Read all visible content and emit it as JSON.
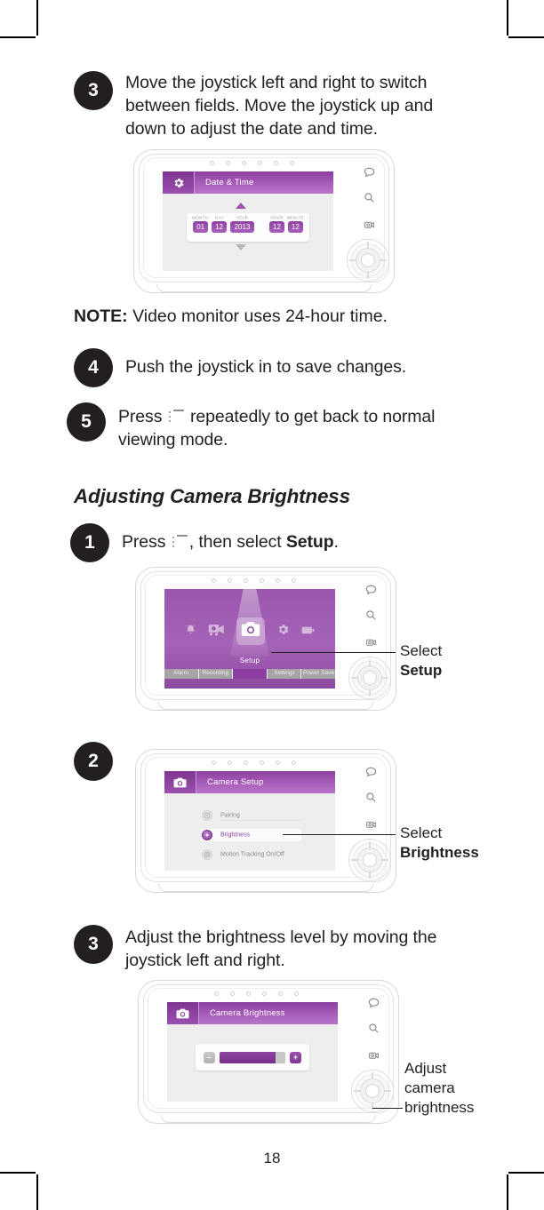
{
  "page": {
    "number": "18"
  },
  "steps": {
    "s3_datetime": {
      "num": "3",
      "text": "Move the joystick left and right to switch between fields. Move the joystick up and down to adjust the date and time."
    },
    "s4": {
      "num": "4",
      "text": "Push the joystick in to save changes."
    },
    "s5": {
      "num": "5",
      "text_before": "Press",
      "icon": "menu-list-icon",
      "text_after": "repeatedly to get back to normal viewing mode."
    },
    "s1_setup": {
      "num": "1",
      "text_before": "Press",
      "icon": "menu-list-icon",
      "text_mid": ", then select",
      "bold": "Setup",
      "text_after": "."
    },
    "s2_brightness": {
      "num": "2"
    },
    "s3_brightness": {
      "num": "3",
      "text": "Adjust the brightness level by moving the joystick left and right."
    }
  },
  "note": {
    "label": "NOTE:",
    "text": "Video monitor uses 24-hour time."
  },
  "heading": {
    "text": "Adjusting Camera Brightness"
  },
  "devices": {
    "datetime": {
      "title": "Date & Time",
      "title_icon": "gear-icon",
      "fields": [
        {
          "label": "MONTH",
          "value": "01",
          "wide": false
        },
        {
          "label": "DAY",
          "value": "12",
          "wide": false
        },
        {
          "label": "YEAR",
          "value": "2013",
          "wide": true
        },
        {
          "label": "HOUR",
          "value": "12",
          "wide": false
        },
        {
          "label": "MINUTE",
          "value": "12",
          "wide": false
        }
      ]
    },
    "setup_menu": {
      "selected_label": "Setup",
      "icons": [
        "alarm-icon",
        "recording-icon",
        "camera-setup-icon",
        "settings-gear-icon",
        "power-save-icon"
      ],
      "tabs": [
        {
          "label": "Alarm",
          "active": false
        },
        {
          "label": "Recording",
          "active": false
        },
        {
          "label": "Setup",
          "active": true
        },
        {
          "label": "Settings",
          "active": false
        },
        {
          "label": "Power Save",
          "active": false
        }
      ]
    },
    "camera_setup": {
      "title": "Camera Setup",
      "title_icon": "camera-icon",
      "items": [
        {
          "label": "Pairing",
          "selected": false
        },
        {
          "label": "Brightness",
          "selected": true
        },
        {
          "label": "Motion Tracking On/Off",
          "selected": false
        }
      ]
    },
    "camera_brightness": {
      "title": "Camera Brightness",
      "title_icon": "camera-icon",
      "minus_label": "–",
      "plus_label": "+",
      "level_percent": 85
    },
    "buttons": [
      "talk-icon",
      "zoom-icon",
      "video-camera-icon",
      "menu-list-icon"
    ]
  },
  "callouts": {
    "setup": {
      "line1": "Select",
      "line2": "Setup"
    },
    "brightness": {
      "line1": "Select",
      "line2": "Brightness"
    },
    "adjust": {
      "line1": "Adjust",
      "line2": "camera",
      "line3": "brightness"
    }
  },
  "colors": {
    "purple_dark": "#7e3591",
    "purple": "#8e43a1",
    "purple_light": "#b974c9",
    "ink": "#231f20",
    "screen_bg": "#eeeeee"
  }
}
